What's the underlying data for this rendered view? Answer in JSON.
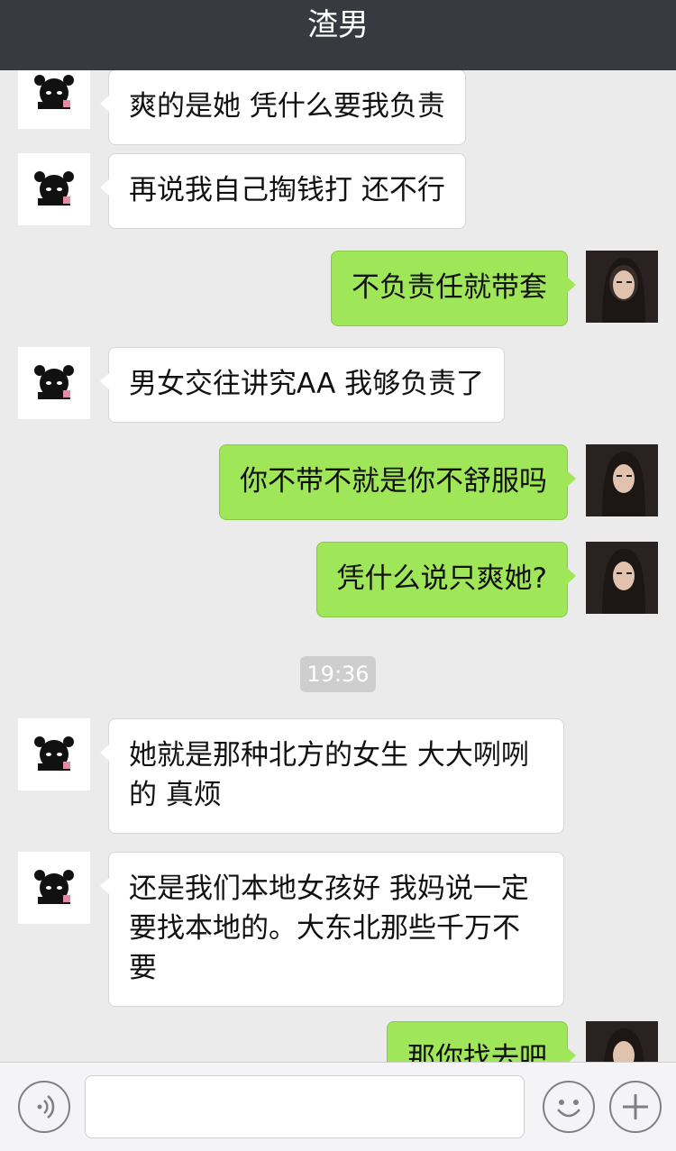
{
  "header": {
    "title": "渣男"
  },
  "messages": [
    {
      "side": "left",
      "text": "爽的是她 凭什么要我负责"
    },
    {
      "side": "left",
      "text": "再说我自己掏钱打 还不行"
    },
    {
      "side": "right",
      "text": "不负责任就带套"
    },
    {
      "side": "left",
      "text": "男女交往讲究AA 我够负责了"
    },
    {
      "side": "right",
      "text": "你不带不就是你不舒服吗"
    },
    {
      "side": "right",
      "text": "凭什么说只爽她?"
    },
    {
      "side": "left",
      "text": "她就是那种北方的女生 大大咧咧的 真烦"
    },
    {
      "side": "left",
      "text": "还是我们本地女孩好 我妈说一定要找本地的。大东北那些千万不要"
    },
    {
      "side": "right",
      "text": "那你找去吧"
    }
  ],
  "timestamp": "19:36",
  "input_bar": {
    "voice_icon": "voice-icon",
    "emoji_icon": "emoji-icon",
    "plus_icon": "plus-icon",
    "message_text": ""
  }
}
